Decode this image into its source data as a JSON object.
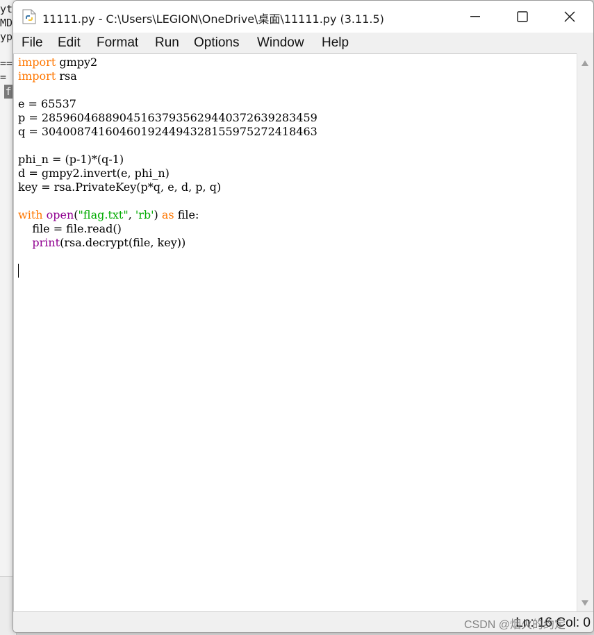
{
  "background_window": {
    "lines": [
      "ytl",
      "MD",
      "yp",
      "",
      "==",
      "=",
      "f"
    ]
  },
  "window": {
    "title": "11111.py - C:\\Users\\LEGION\\OneDrive\\桌面\\11111.py (3.11.5)"
  },
  "menu": {
    "items": [
      "File",
      "Edit",
      "Format",
      "Run",
      "Options",
      "Window",
      "Help"
    ]
  },
  "editor": {
    "lines": [
      [
        {
          "t": "import",
          "c": "kw"
        },
        {
          "t": " gmpy2",
          "c": ""
        }
      ],
      [
        {
          "t": "import",
          "c": "kw"
        },
        {
          "t": " rsa",
          "c": ""
        }
      ],
      [],
      [
        {
          "t": "e = 65537",
          "c": ""
        }
      ],
      [
        {
          "t": "p = 285960468890451637935629440372639283459",
          "c": ""
        }
      ],
      [
        {
          "t": "q = 304008741604601924494328155975272418463",
          "c": ""
        }
      ],
      [],
      [
        {
          "t": "phi_n = (p-1)*(q-1)",
          "c": ""
        }
      ],
      [
        {
          "t": "d = gmpy2.invert(e, phi_n)",
          "c": ""
        }
      ],
      [
        {
          "t": "key = rsa.PrivateKey(p*q, e, d, p, q)",
          "c": ""
        }
      ],
      [],
      [
        {
          "t": "with",
          "c": "kw"
        },
        {
          "t": " ",
          "c": ""
        },
        {
          "t": "open",
          "c": "bi"
        },
        {
          "t": "(",
          "c": ""
        },
        {
          "t": "\"flag.txt\"",
          "c": "str"
        },
        {
          "t": ", ",
          "c": ""
        },
        {
          "t": "'rb'",
          "c": "str"
        },
        {
          "t": ") ",
          "c": ""
        },
        {
          "t": "as",
          "c": "kw"
        },
        {
          "t": " file:",
          "c": ""
        }
      ],
      [
        {
          "t": "    file = file.read()",
          "c": ""
        }
      ],
      [
        {
          "t": "    ",
          "c": ""
        },
        {
          "t": "print",
          "c": "bi"
        },
        {
          "t": "(rsa.decrypt(file, key))",
          "c": ""
        }
      ]
    ]
  },
  "status": {
    "position": "Ln: 16   Col: 0"
  },
  "watermark": "CSDN @烟火的约定",
  "colors": {
    "keyword": "#ff7700",
    "builtin": "#900090",
    "string": "#00aa00"
  },
  "icons": {
    "app": "python-file-icon",
    "minimize": "minimize-icon",
    "maximize": "maximize-icon",
    "close": "close-icon"
  }
}
